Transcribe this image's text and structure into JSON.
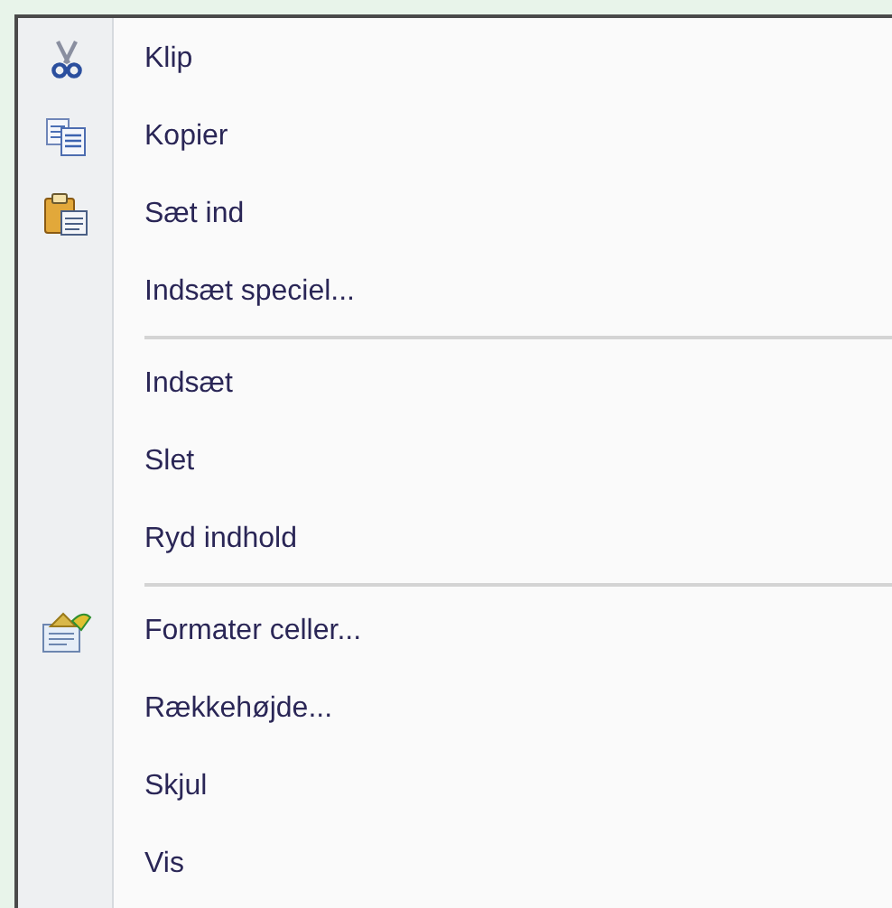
{
  "menu": {
    "groups": [
      {
        "items": [
          {
            "label": "Klip",
            "kind": "cut"
          },
          {
            "label": "Kopier",
            "kind": "copy"
          },
          {
            "label": "Sæt ind",
            "kind": "paste"
          },
          {
            "label": "Indsæt speciel...",
            "kind": "plain"
          }
        ]
      },
      {
        "items": [
          {
            "label": "Indsæt",
            "kind": "plain"
          },
          {
            "label": "Slet",
            "kind": "plain"
          },
          {
            "label": "Ryd indhold",
            "kind": "plain"
          }
        ]
      },
      {
        "items": [
          {
            "label": "Formater celler...",
            "kind": "format"
          },
          {
            "label": "Rækkehøjde...",
            "kind": "plain"
          },
          {
            "label": "Skjul",
            "kind": "plain"
          },
          {
            "label": "Vis",
            "kind": "plain"
          }
        ]
      }
    ]
  }
}
